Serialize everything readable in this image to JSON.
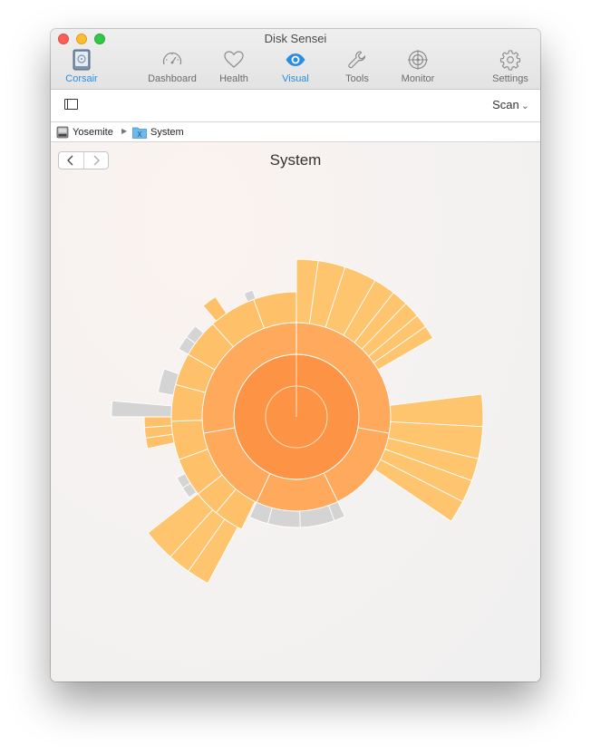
{
  "window": {
    "title": "Disk Sensei"
  },
  "toolbar": {
    "items": [
      {
        "label": "Corsair",
        "icon": "drive-icon",
        "active": true
      },
      {
        "label": "Dashboard",
        "icon": "gauge-icon"
      },
      {
        "label": "Health",
        "icon": "heart-icon"
      },
      {
        "label": "Visual",
        "icon": "eye-icon",
        "active": true
      },
      {
        "label": "Tools",
        "icon": "wrench-icon"
      },
      {
        "label": "Monitor",
        "icon": "crosshair-icon"
      },
      {
        "label": "Settings",
        "icon": "gear-icon"
      }
    ]
  },
  "actions": {
    "scan_label": "Scan"
  },
  "breadcrumb": {
    "volume": "Yosemite",
    "folder": "System"
  },
  "view": {
    "title": "System"
  },
  "colors": {
    "accent": "#2b8de2",
    "core": "#fd9445",
    "level1": "#fea95c",
    "level2": "#ffc06a",
    "level3": "#ffc46e",
    "other": "#d4d4d4"
  }
}
